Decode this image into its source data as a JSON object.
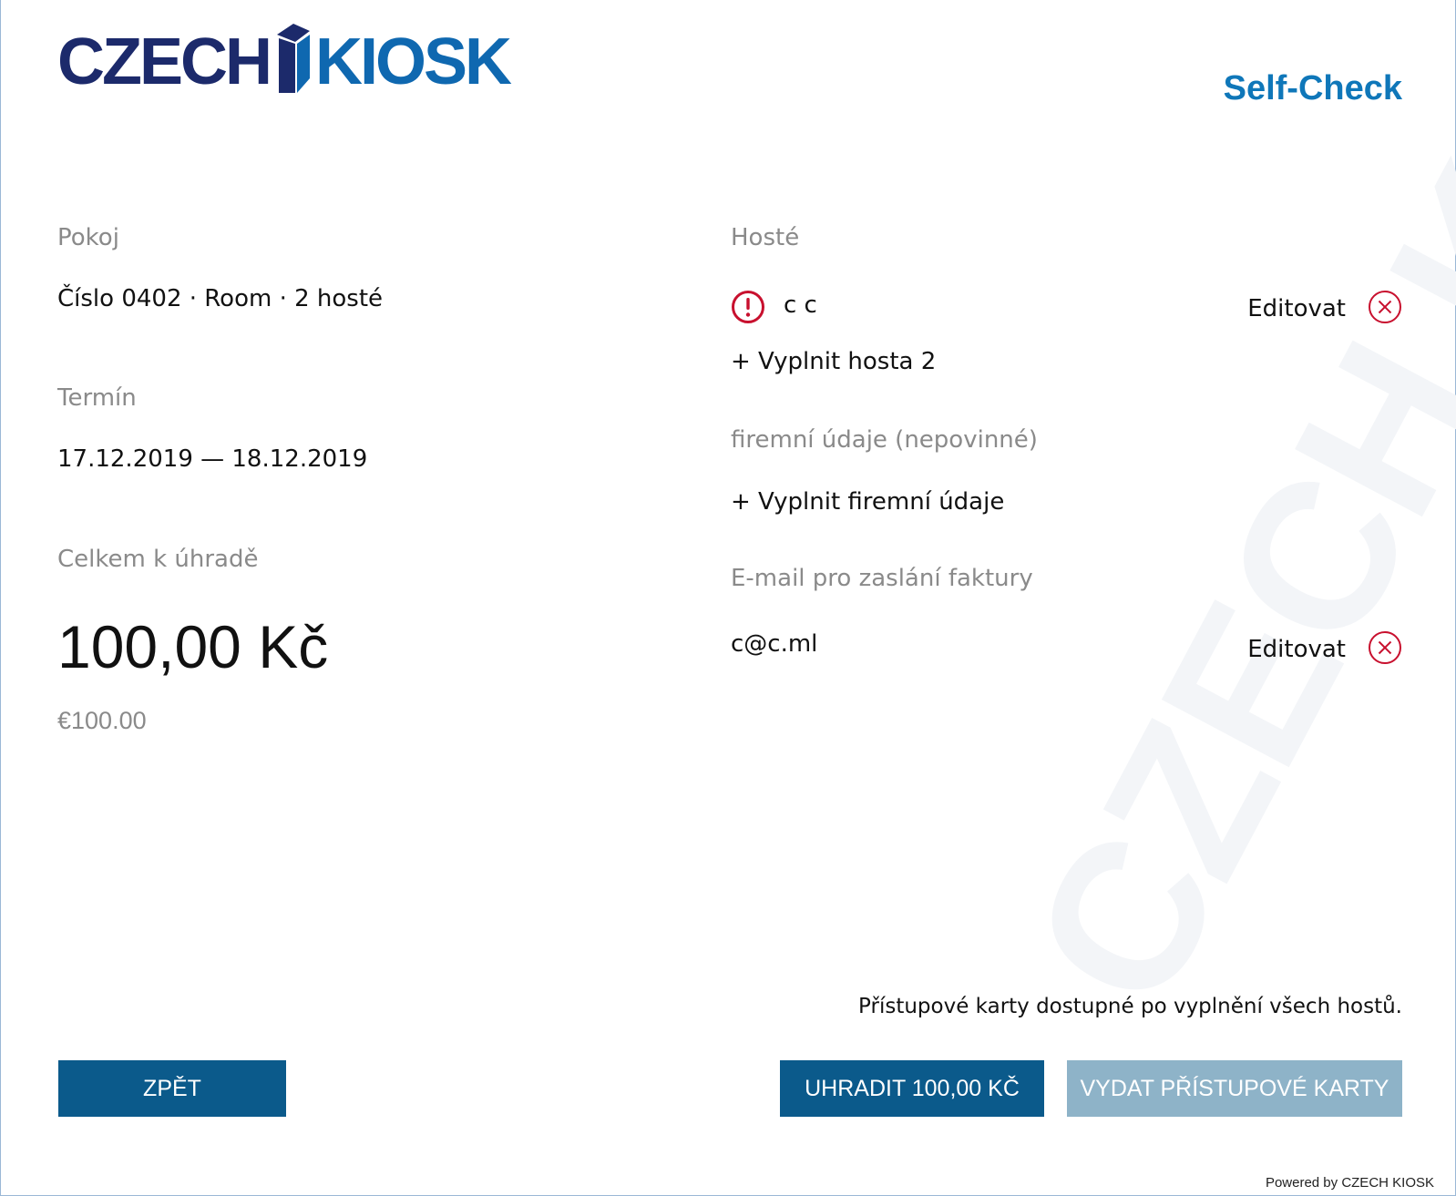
{
  "header": {
    "logo_left": "CZECH",
    "logo_right": "KIOSK",
    "title": "Self-Check"
  },
  "watermark": "CZECH KIOSK",
  "room": {
    "label": "Pokoj",
    "value": "Číslo 0402 · Room · 2 hosté"
  },
  "term": {
    "label": "Termín",
    "value": "17.12.2019 — 18.12.2019"
  },
  "total": {
    "label": "Celkem k úhradě",
    "amount": "100,00 Kč",
    "amount_eur": "€100.00"
  },
  "guests": {
    "label": "Hosté",
    "items": [
      {
        "name": "c c",
        "status_icon": "warning-icon",
        "edit_label": "Editovat",
        "remove_icon": "close-circle-icon"
      }
    ],
    "add_label": "+ Vyplnit hosta 2"
  },
  "company": {
    "label": "firemní údaje (nepovinné)",
    "add_label": "+ Vyplnit firemní údaje"
  },
  "invoice_email": {
    "label": "E-mail pro zaslání faktury",
    "value": "c@c.ml",
    "edit_label": "Editovat",
    "remove_icon": "close-circle-icon"
  },
  "notice": "Přístupové karty dostupné po vyplnění všech hostů.",
  "buttons": {
    "back": "ZPĚT",
    "pay": "UHRADIT 100,00 KČ",
    "issue_cards": "VYDAT PŘÍSTUPOVÉ KARTY"
  },
  "footer": {
    "powered_by": "Powered by CZECH KIOSK"
  },
  "colors": {
    "primary_button": "#0b5a8b",
    "disabled_button": "#8eb3c8",
    "accent_title": "#0f77b9",
    "error_red": "#c8102e"
  }
}
